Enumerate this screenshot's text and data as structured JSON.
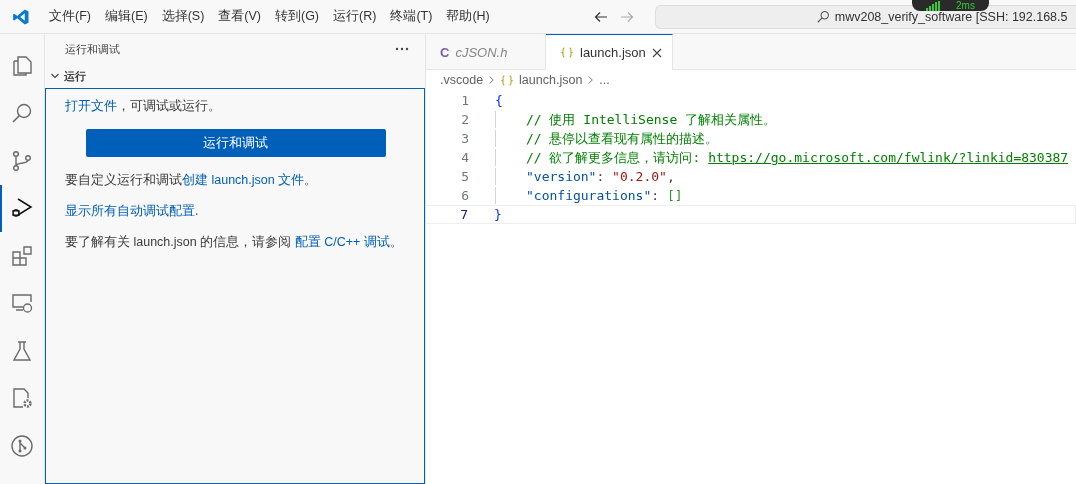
{
  "menu": [
    "文件(F)",
    "编辑(E)",
    "选择(S)",
    "查看(V)",
    "转到(G)",
    "运行(R)",
    "终端(T)",
    "帮助(H)"
  ],
  "command_center": {
    "text": "mwv208_verify_software [SSH: 192.168.5",
    "latency": "2ms"
  },
  "activity_bar": [
    {
      "kind": "explorer",
      "selected": false
    },
    {
      "kind": "search",
      "selected": false
    },
    {
      "kind": "source-control",
      "selected": false
    },
    {
      "kind": "run-debug",
      "selected": true
    },
    {
      "kind": "extensions",
      "selected": false
    },
    {
      "kind": "remote",
      "selected": false
    },
    {
      "kind": "testing",
      "selected": false
    },
    {
      "kind": "cpp-config",
      "selected": false
    },
    {
      "kind": "git-graph",
      "selected": false
    }
  ],
  "sidebar": {
    "title": "运行和调试",
    "section": {
      "label": "运行",
      "expanded": true
    },
    "paragraphs": [
      [
        {
          "text": "打开文件",
          "link": true
        },
        {
          "text": "，可调试或运行。",
          "link": false
        }
      ]
    ],
    "button": "运行和调试",
    "paragraphs_after": [
      [
        {
          "text": "要自定义运行和调试",
          "link": false
        },
        {
          "text": "创建 launch.json 文件",
          "link": true
        },
        {
          "text": "。",
          "link": false
        }
      ],
      [
        {
          "text": "显示所有自动调试配置",
          "link": true
        },
        {
          "text": ".",
          "link": false
        }
      ],
      [
        {
          "text": "要了解有关 launch.json 的信息，请参阅 ",
          "link": false
        },
        {
          "text": "配置 C/C++ 调试",
          "link": true
        },
        {
          "text": "。",
          "link": false
        }
      ]
    ]
  },
  "tabs": [
    {
      "label": "cJSON.h",
      "kind": "c",
      "icon": "C",
      "selected": false,
      "preview": true
    },
    {
      "label": "launch.json",
      "kind": "json",
      "selected": true,
      "preview": false
    }
  ],
  "breadcrumbs": [
    {
      "label": ".vscode",
      "kind": "folder"
    },
    {
      "label": "launch.json",
      "kind": "json"
    },
    {
      "label": "...",
      "kind": "symbol"
    }
  ],
  "code": [
    {
      "number": "1",
      "current": false,
      "indented": false,
      "tokens": [
        {
          "text": "{",
          "kind": "brace"
        }
      ]
    },
    {
      "number": "2",
      "current": false,
      "indented": true,
      "tokens": [
        {
          "text": "// 使用 IntelliSense 了解相关属性。",
          "kind": "comment"
        }
      ]
    },
    {
      "number": "3",
      "current": false,
      "indented": true,
      "tokens": [
        {
          "text": "// 悬停以查看现有属性的描述。",
          "kind": "comment"
        }
      ]
    },
    {
      "number": "4",
      "current": false,
      "indented": true,
      "tokens": [
        {
          "text": "// 欲了解更多信息，请访问: ",
          "kind": "comment"
        },
        {
          "text": "https://go.microsoft.com/fwlink/?linkid=830387",
          "kind": "url"
        }
      ]
    },
    {
      "number": "5",
      "current": false,
      "indented": true,
      "tokens": [
        {
          "text": "\"version\"",
          "kind": "key"
        },
        {
          "text": ": ",
          "kind": "punct"
        },
        {
          "text": "\"0.2.0\"",
          "kind": "string"
        },
        {
          "text": ",",
          "kind": "punct"
        }
      ]
    },
    {
      "number": "6",
      "current": false,
      "indented": true,
      "tokens": [
        {
          "text": "\"configurations\"",
          "kind": "key"
        },
        {
          "text": ": ",
          "kind": "punct"
        },
        {
          "text": "[]",
          "kind": "bracket"
        }
      ]
    },
    {
      "number": "7",
      "current": true,
      "indented": false,
      "tokens": [
        {
          "text": "}",
          "kind": "brace"
        }
      ]
    }
  ]
}
